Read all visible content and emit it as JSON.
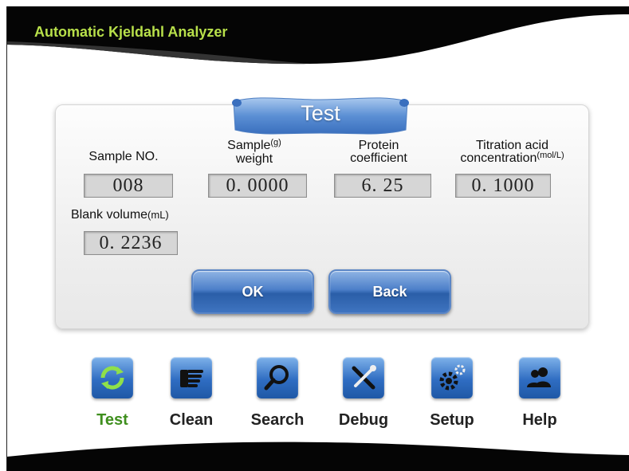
{
  "header": {
    "title": "Automatic Kjeldahl Analyzer"
  },
  "dialog": {
    "title": "Test",
    "fields": {
      "sample_no": {
        "label": "Sample NO.",
        "value": "008"
      },
      "sample_weight": {
        "label_line1": "Sample",
        "unit": "(g)",
        "label_line2": "weight",
        "value": "0. 0000"
      },
      "protein_coefficient": {
        "label_line1": "Protein",
        "label_line2": "coefficient",
        "value": "6. 25"
      },
      "titration_acid": {
        "label_line1": "Titration acid",
        "label_line2": "concentration",
        "unit": "(mol/L)",
        "value": "0. 1000"
      },
      "blank_volume": {
        "label": "Blank volume",
        "unit": "(mL)",
        "value": "0. 2236"
      }
    },
    "buttons": {
      "ok": "OK",
      "back": "Back"
    }
  },
  "nav": {
    "items": [
      {
        "label": "Test",
        "icon": "refresh-icon",
        "active": true
      },
      {
        "label": "Clean",
        "icon": "hand-icon",
        "active": false
      },
      {
        "label": "Search",
        "icon": "magnifier-icon",
        "active": false
      },
      {
        "label": "Debug",
        "icon": "tools-icon",
        "active": false
      },
      {
        "label": "Setup",
        "icon": "gears-icon",
        "active": false
      },
      {
        "label": "Help",
        "icon": "users-icon",
        "active": false
      }
    ]
  },
  "colors": {
    "title": "#b8e04a",
    "active_nav": "#3f8f1e",
    "button_blue": "#3f74c0"
  }
}
